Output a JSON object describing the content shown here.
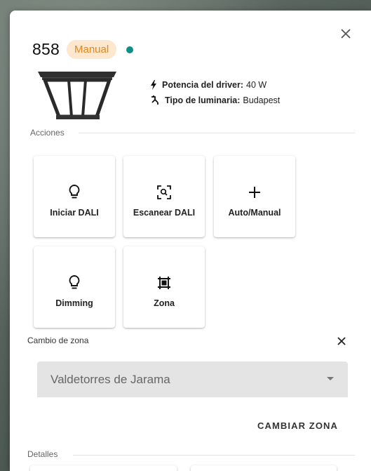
{
  "header": {
    "id_number": "858",
    "mode_badge": "Manual",
    "status_color": "#0f8f86"
  },
  "specs": {
    "driver_power_label": "Potencia del driver:",
    "driver_power_value": "40 W",
    "luminaire_type_label": "Tipo de luminaria:",
    "luminaire_type_value": "Budapest"
  },
  "sections": {
    "actions_title": "Acciones",
    "details_title": "Detalles"
  },
  "actions": [
    {
      "label": "Iniciar DALI",
      "icon": "lightbulb-icon"
    },
    {
      "label": "Escanear DALI",
      "icon": "scan-icon"
    },
    {
      "label": "Auto/Manual",
      "icon": "plus-icon"
    },
    {
      "label": "Dimming",
      "icon": "lightbulb-icon"
    },
    {
      "label": "Zona",
      "icon": "zone-grid-icon"
    }
  ],
  "zone_change": {
    "label": "Cambio de zona",
    "selected_value": "Valdetorres de Jarama",
    "submit_label": "CAMBIAR ZONA"
  },
  "colors": {
    "badge_bg": "#fde7cf",
    "badge_text": "#e0871e",
    "select_bg": "#e4e4e4"
  }
}
